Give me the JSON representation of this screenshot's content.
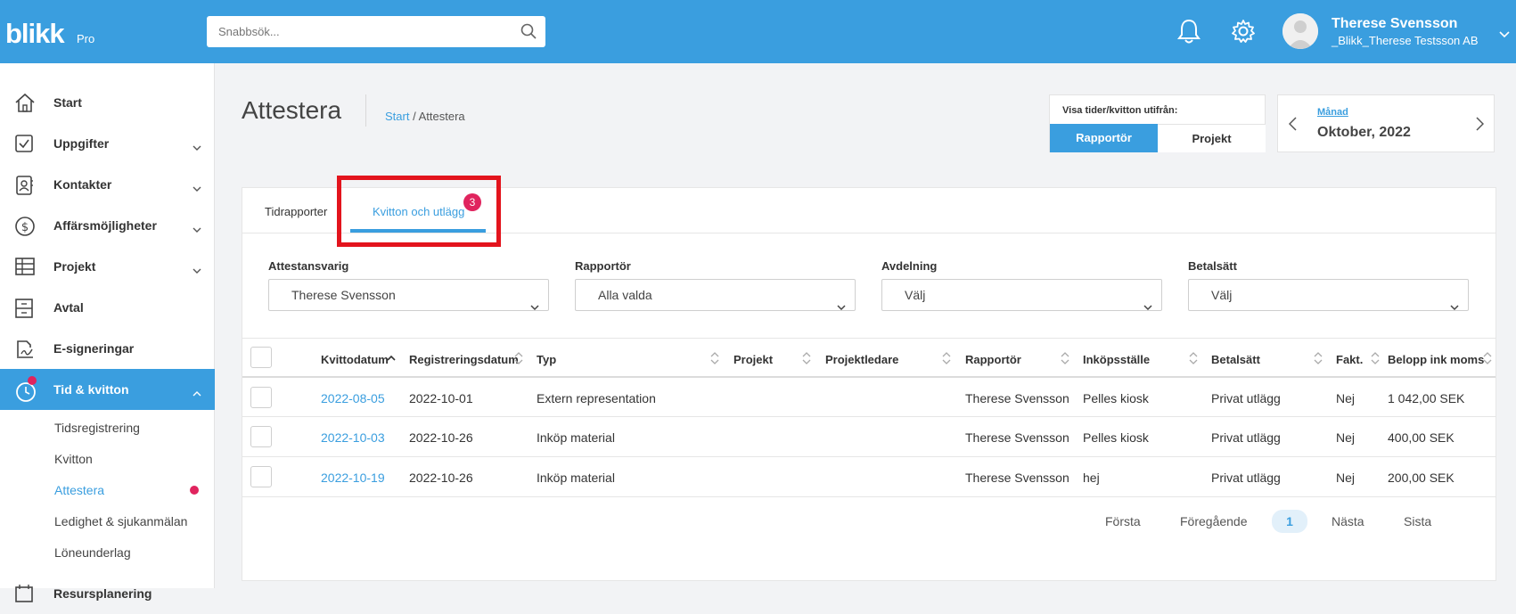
{
  "header": {
    "logo_text": "blikk",
    "logo_pro": "Pro",
    "search_placeholder": "Snabbsök...",
    "user_name": "Therese Svensson",
    "user_company": "_Blikk_Therese Testsson AB"
  },
  "sidebar": {
    "items": [
      {
        "label": "Start",
        "icon": "house-icon"
      },
      {
        "label": "Uppgifter",
        "icon": "checkbox-icon"
      },
      {
        "label": "Kontakter",
        "icon": "contacts-icon"
      },
      {
        "label": "Affärsmöjligheter",
        "icon": "dollar-icon"
      },
      {
        "label": "Projekt",
        "icon": "table-icon"
      },
      {
        "label": "Avtal",
        "icon": "cabinet-icon"
      },
      {
        "label": "E-signeringar",
        "icon": "signature-icon"
      },
      {
        "label": "Tid & kvitton",
        "icon": "clock-icon"
      }
    ],
    "sub_items": [
      {
        "label": "Tidsregistrering"
      },
      {
        "label": "Kvitton"
      },
      {
        "label": "Attestera"
      },
      {
        "label": "Ledighet & sjukanmälan"
      },
      {
        "label": "Löneunderlag"
      }
    ],
    "cut_item": "Resursplanering"
  },
  "page": {
    "title": "Attestera",
    "breadcrumb_start": "Start",
    "breadcrumb_sep": "/",
    "breadcrumb_current": "Attestera"
  },
  "view_toggle": {
    "label": "Visa tider/kvitton utifrån:",
    "option_reporter": "Rapportör",
    "option_project": "Projekt"
  },
  "period": {
    "unit": "Månad",
    "value": "Oktober, 2022"
  },
  "tabs": {
    "time_reports": "Tidrapporter",
    "receipts": "Kvitton och utlägg",
    "receipts_badge": "3"
  },
  "filters": [
    {
      "label": "Attestansvarig",
      "value": "Therese Svensson"
    },
    {
      "label": "Rapportör",
      "value": "Alla valda"
    },
    {
      "label": "Avdelning",
      "value": "Välj"
    },
    {
      "label": "Betalsätt",
      "value": "Välj"
    }
  ],
  "table": {
    "headers": [
      "Kvittodatum",
      "Registreringsdatum",
      "Typ",
      "Projekt",
      "Projektledare",
      "Rapportör",
      "Inköpsställe",
      "Betalsätt",
      "Fakt.",
      "Belopp ink moms"
    ],
    "rows": [
      {
        "receipt_date": "2022-08-05",
        "reg_date": "2022-10-01",
        "type": "Extern representation",
        "project": "",
        "pm": "",
        "reporter": "Therese Svensson",
        "store": "Pelles kiosk",
        "payment": "Privat utlägg",
        "invoiced": "Nej",
        "amount": "1 042,00 SEK"
      },
      {
        "receipt_date": "2022-10-03",
        "reg_date": "2022-10-26",
        "type": "Inköp material",
        "project": "",
        "pm": "",
        "reporter": "Therese Svensson",
        "store": "Pelles kiosk",
        "payment": "Privat utlägg",
        "invoiced": "Nej",
        "amount": "400,00 SEK"
      },
      {
        "receipt_date": "2022-10-19",
        "reg_date": "2022-10-26",
        "type": "Inköp material",
        "project": "",
        "pm": "",
        "reporter": "Therese Svensson",
        "store": "hej",
        "payment": "Privat utlägg",
        "invoiced": "Nej",
        "amount": "200,00 SEK"
      }
    ]
  },
  "pagination": {
    "first": "Första",
    "prev": "Föregående",
    "current": "1",
    "next": "Nästa",
    "last": "Sista"
  },
  "colors": {
    "accent": "#3a9edf",
    "badge": "#e0245e",
    "highlight": "#e3141d"
  }
}
